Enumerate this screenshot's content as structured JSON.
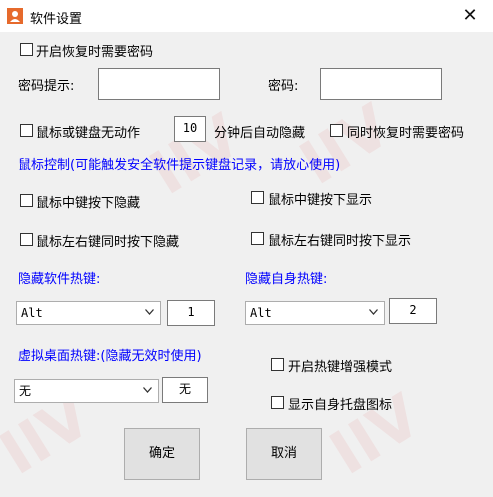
{
  "window": {
    "title": "软件设置",
    "close_glyph": "✕",
    "app_icon": "user-icon"
  },
  "options": {
    "require_password_resume": "开启恢复时需要密码",
    "password_hint_label": "密码提示:",
    "password_hint_value": "",
    "password_label": "密码:",
    "password_value": "",
    "idle_label": "鼠标或键盘无动作",
    "idle_minutes": "10",
    "idle_after": "分钟后自动隐藏",
    "idle_require_password": "同时恢复时需要密码"
  },
  "mouse": {
    "heading": "鼠标控制(可能触发安全软件提示键盘记录，请放心使用)",
    "middle_hide": "鼠标中键按下隐藏",
    "middle_show": "鼠标中键按下显示",
    "lr_hide": "鼠标左右键同时按下隐藏",
    "lr_show": "鼠标左右键同时按下显示"
  },
  "hotkeys": {
    "hide_app_label": "隐藏软件热键:",
    "hide_app_mod": "Alt",
    "hide_app_key": "1",
    "hide_self_label": "隐藏自身热键:",
    "hide_self_mod": "Alt",
    "hide_self_key": "2",
    "vdesk_label": "虚拟桌面热键:(隐藏无效时使用)",
    "vdesk_mod": "无",
    "vdesk_key": "无",
    "enhanced_mode": "开启热键增强模式",
    "tray_icon": "显示自身托盘图标"
  },
  "buttons": {
    "ok": "确定",
    "cancel": "取消"
  },
  "colors": {
    "accent_text": "#0000ff",
    "watermark": "#e8a0a0"
  }
}
